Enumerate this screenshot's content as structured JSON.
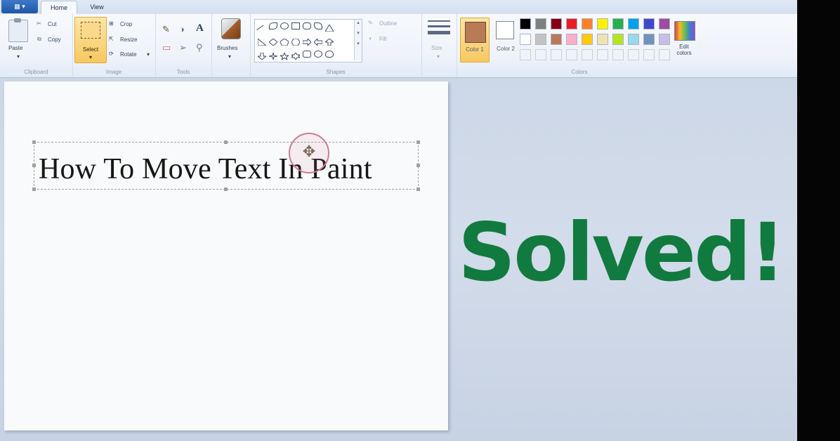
{
  "ribbon": {
    "tabs": {
      "home": "Home",
      "view": "View"
    },
    "clipboard": {
      "paste": "Paste",
      "cut": "Cut",
      "copy": "Copy",
      "group": "Clipboard"
    },
    "image": {
      "select": "Select",
      "crop": "Crop",
      "resize": "Resize",
      "rotate": "Rotate",
      "group": "Image"
    },
    "tools": {
      "group": "Tools"
    },
    "brushes": {
      "label": "Brushes"
    },
    "shapes": {
      "outline": "Outline",
      "fill": "Fill",
      "group": "Shapes"
    },
    "size": {
      "label": "Size"
    },
    "colors": {
      "color1": "Color 1",
      "color2": "Color 2",
      "edit": "Edit colors",
      "group": "Colors",
      "palette_row1": [
        "#000000",
        "#7f7f7f",
        "#880015",
        "#ed1c24",
        "#ff7f27",
        "#fff200",
        "#22b14c",
        "#00a2e8",
        "#3f48cc",
        "#a349a4"
      ],
      "palette_row2": [
        "#ffffff",
        "#c3c3c3",
        "#b97a57",
        "#ffaec9",
        "#ffc90e",
        "#efe4b0",
        "#b5e61d",
        "#99d9ea",
        "#7092be",
        "#c8bfe7"
      ],
      "selected_color1": "#b97a57",
      "selected_color2": "#ffffff"
    }
  },
  "canvas": {
    "text": "How To Move Text In Paint"
  },
  "overlay": {
    "headline": "Solved!",
    "headline_color": "#117a3f"
  }
}
